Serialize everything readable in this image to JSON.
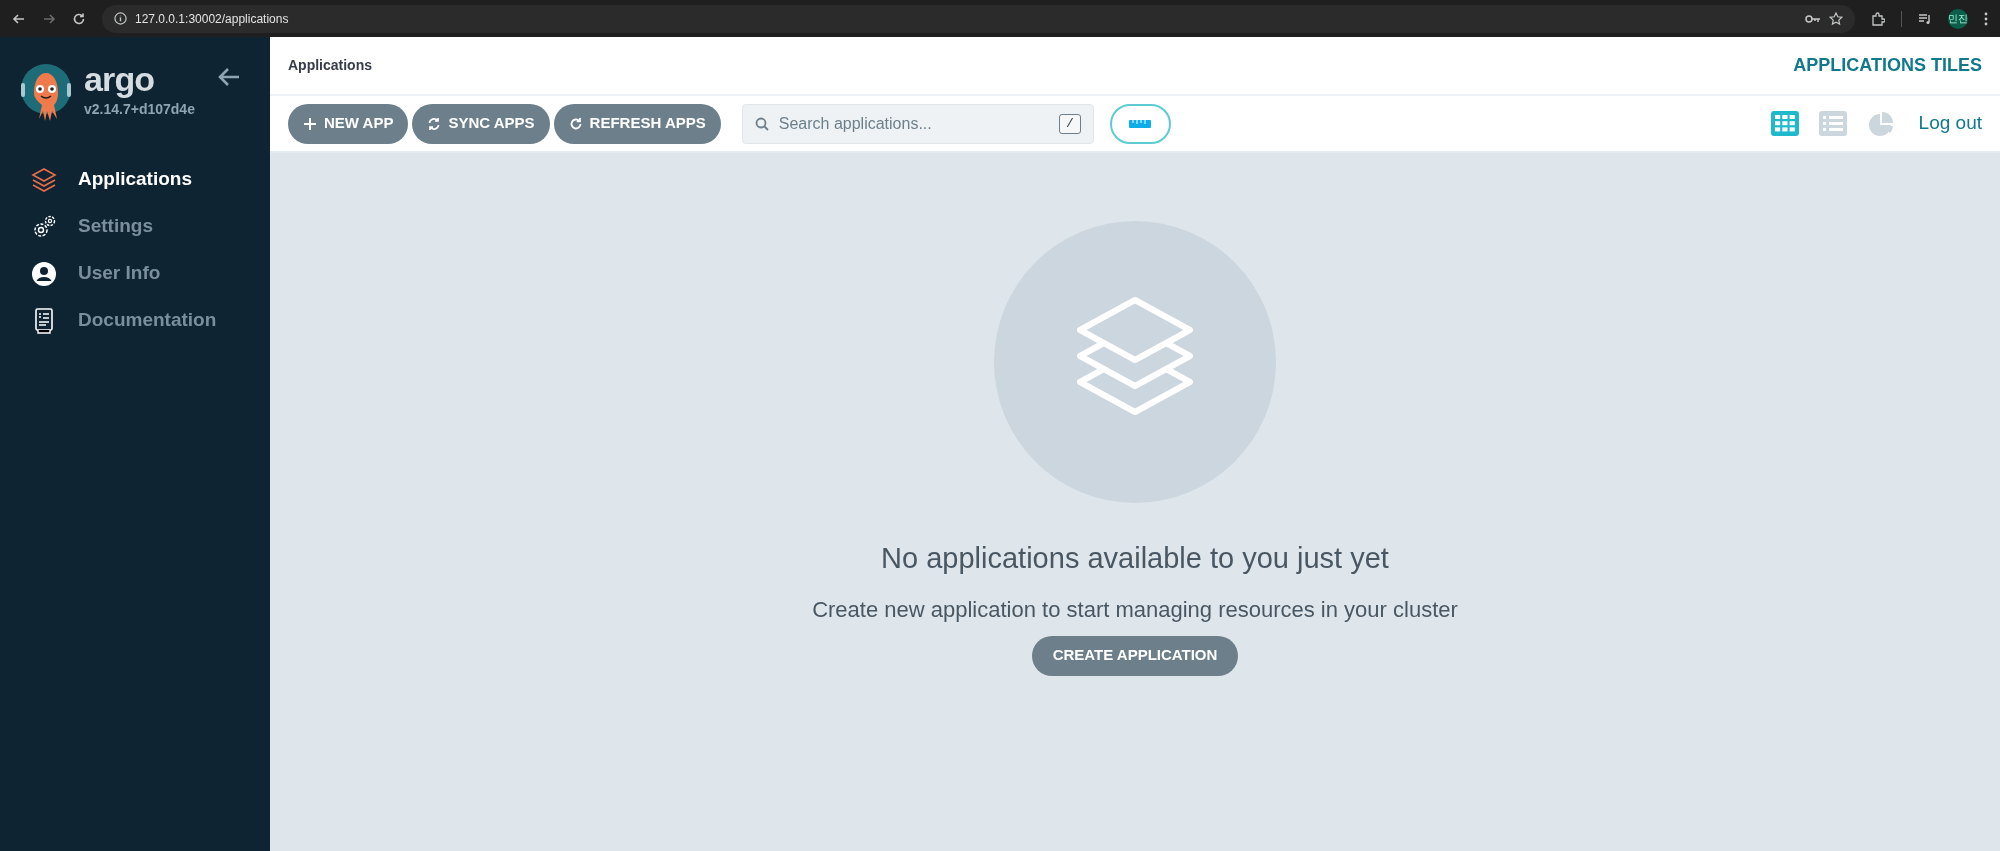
{
  "browser": {
    "url": "127.0.0.1:30002/applications",
    "profile": "민진"
  },
  "sidebar": {
    "logo_text": "argo",
    "version": "v2.14.7+d107d4e",
    "items": [
      {
        "label": "Applications",
        "kind": "layers",
        "selected": true
      },
      {
        "label": "Settings",
        "kind": "gears",
        "selected": false
      },
      {
        "label": "User Info",
        "kind": "user",
        "selected": false
      },
      {
        "label": "Documentation",
        "kind": "doc",
        "selected": false
      }
    ]
  },
  "header": {
    "title": "Applications",
    "view_title": "APPLICATIONS TILES"
  },
  "toolbar": {
    "buttons": [
      {
        "label": "NEW APP",
        "kind": "plus"
      },
      {
        "label": "SYNC APPS",
        "kind": "sync"
      },
      {
        "label": "REFRESH APPS",
        "kind": "refresh"
      }
    ],
    "search": {
      "placeholder": "Search applications...",
      "shortcut": "/"
    },
    "views": [
      {
        "kind": "tiles",
        "selected": true
      },
      {
        "kind": "list",
        "selected": false
      },
      {
        "kind": "summary",
        "selected": false
      }
    ],
    "logout": "Log out"
  },
  "empty_state": {
    "heading": "No applications available to you just yet",
    "text": "Create new application to start managing resources in your cluster",
    "button": "CREATE APPLICATION"
  }
}
